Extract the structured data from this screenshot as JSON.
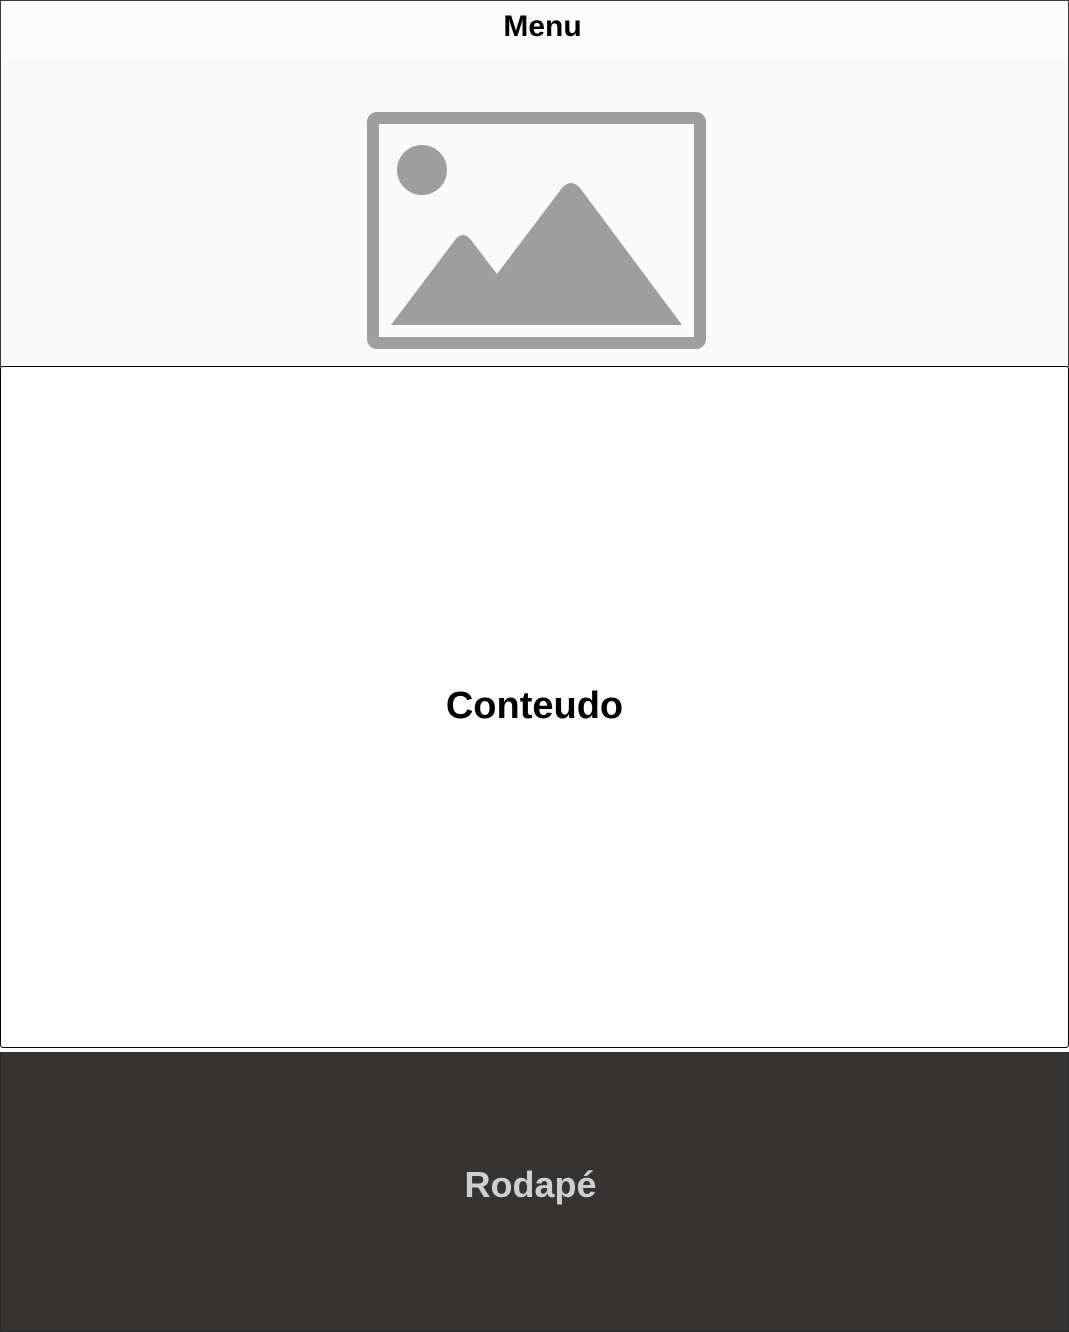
{
  "menu": {
    "label": "Menu"
  },
  "banner": {
    "image_icon": "image-placeholder-icon",
    "icon_color": "#9e9e9e"
  },
  "content": {
    "label": "Conteudo"
  },
  "footer": {
    "label": "Rodapé",
    "background_color": "#353433",
    "text_color": "#cfcfcf"
  }
}
